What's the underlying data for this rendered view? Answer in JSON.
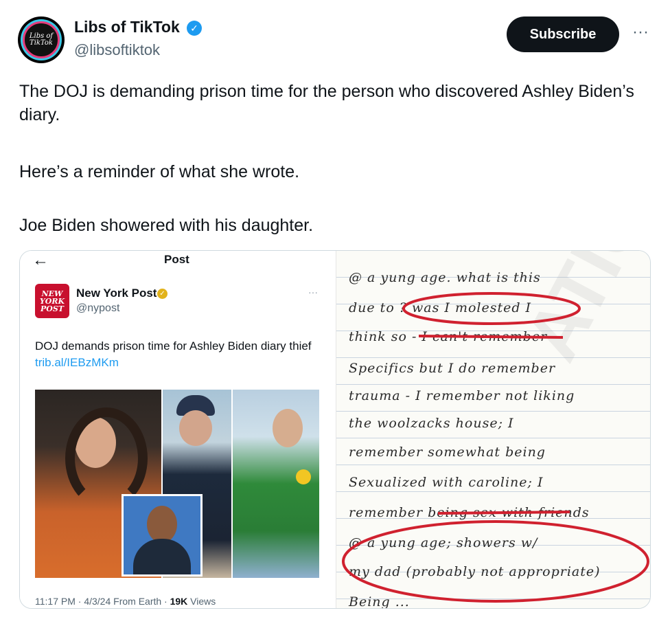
{
  "post": {
    "avatar_text": "Libs of\nTikTok",
    "author_name": "Libs of TikTok",
    "verified_glyph": "✓",
    "handle": "@libsoftiktok",
    "subscribe_label": "Subscribe",
    "more_glyph": "···",
    "text_line1": "The DOJ is demanding prison time for the person who discovered Ashley Biden’s diary.",
    "text_line2": "Here’s a reminder of what she wrote.",
    "text_line3": "Joe Biden showered with his daughter."
  },
  "embedded": {
    "back_glyph": "←",
    "title": "Post",
    "logo_text": "NEW\nYORK\nPOST",
    "author_name": "New York Post",
    "badge_glyph": "✓",
    "handle": "@nypost",
    "more_glyph": "···",
    "text": "DOJ demands prison time for Ashley Biden diary thief ",
    "link": "trib.al/IEBzMKm",
    "time": "11:17 PM · 4/3/24 From Earth · ",
    "views_count": "19K",
    "views_label": " Views"
  },
  "diary": {
    "lines": [
      "@ a yung age.  what is this",
      "due to ? was I molested  I",
      "think so -  I can't remember",
      "Specifics but I do remember",
      "trauma -  I remember not liking",
      "the woolzacks house;  I",
      "remember somewhat being",
      "Sexualized with caroline;  I",
      "remember being sex with friends",
      "@ a yung age;  showers w/",
      "my dad (probably not appropriate)",
      "Being ..."
    ],
    "watermark": "ATION"
  },
  "colors": {
    "accent_blue": "#1d9bf0",
    "nyp_red": "#c8102e",
    "annotation_red": "#d0212f"
  }
}
